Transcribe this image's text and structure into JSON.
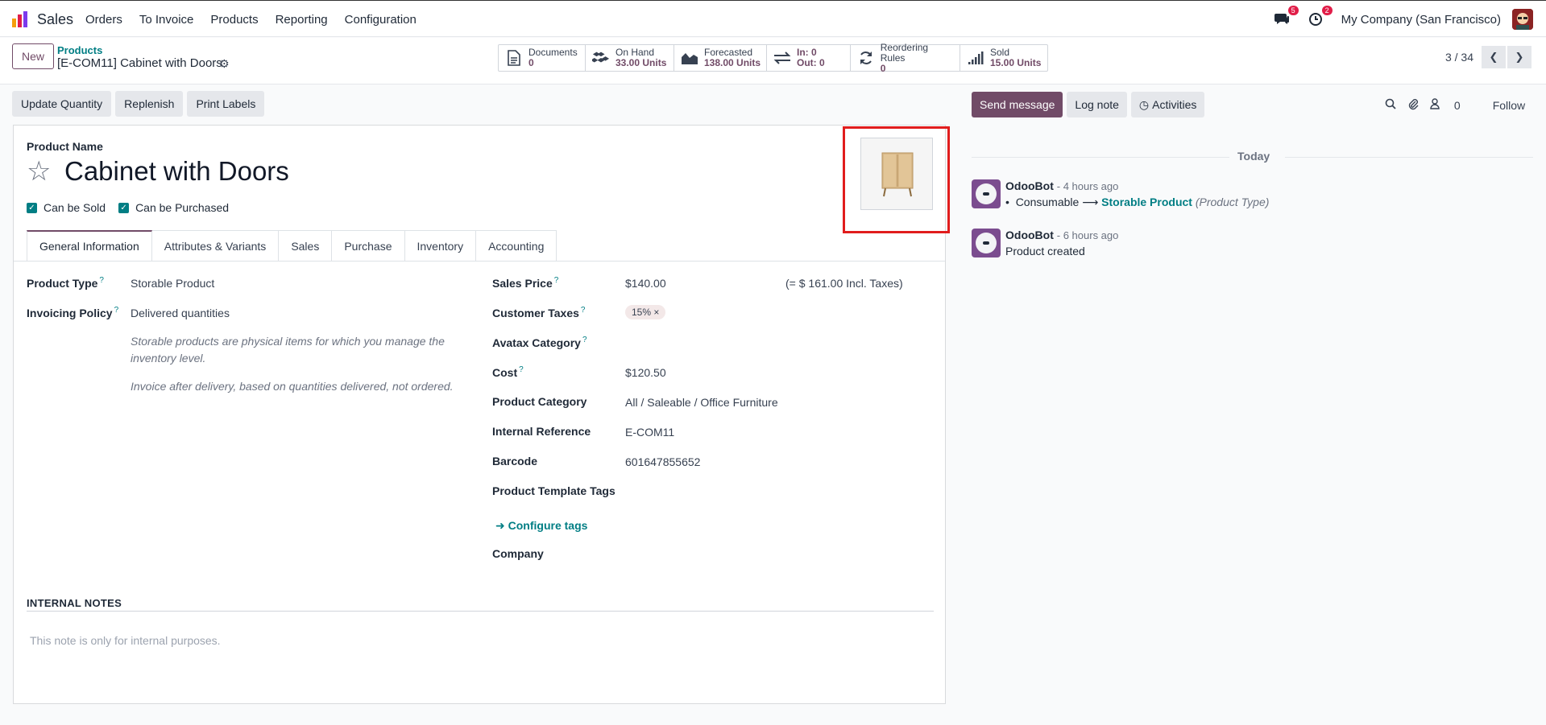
{
  "navbar": {
    "app_name": "Sales",
    "menu": [
      "Orders",
      "To Invoice",
      "Products",
      "Reporting",
      "Configuration"
    ],
    "messages_badge": "5",
    "activities_badge": "2",
    "company": "My Company (San Francisco)"
  },
  "breadcrumb": {
    "new_label": "New",
    "parent": "Products",
    "current": "[E-COM11] Cabinet with Doors"
  },
  "smart_buttons": [
    {
      "icon": "documents-icon",
      "label": "Documents",
      "value": "0"
    },
    {
      "icon": "on-hand-icon",
      "label": "On Hand",
      "value": "33.00 Units"
    },
    {
      "icon": "forecasted-icon",
      "label": "Forecasted",
      "value": "138.00 Units"
    },
    {
      "icon": "in-out-icon",
      "label": "In: 0",
      "value": "Out: 0"
    },
    {
      "icon": "reordering-icon",
      "label": "Reordering Rules",
      "value": "0"
    },
    {
      "icon": "sold-icon",
      "label": "Sold",
      "value": "15.00 Units"
    }
  ],
  "pager": {
    "text": "3 / 34"
  },
  "status_buttons": [
    "Update Quantity",
    "Replenish",
    "Print Labels"
  ],
  "form": {
    "product_name_label": "Product Name",
    "product_name": "Cabinet with Doors",
    "can_be_sold": "Can be Sold",
    "can_be_purchased": "Can be Purchased",
    "tabs": [
      "General Information",
      "Attributes & Variants",
      "Sales",
      "Purchase",
      "Inventory",
      "Accounting"
    ],
    "left": {
      "product_type_label": "Product Type",
      "product_type": "Storable Product",
      "invoicing_policy_label": "Invoicing Policy",
      "invoicing_policy": "Delivered quantities",
      "help1_line1": "Storable products are physical items for which you manage the",
      "help1_line2": "inventory level.",
      "help2": "Invoice after delivery, based on quantities delivered, not ordered."
    },
    "right": {
      "sales_price_label": "Sales Price",
      "sales_price": "$140.00",
      "incl_taxes": "(= $ 161.00 Incl. Taxes)",
      "customer_taxes_label": "Customer Taxes",
      "tax_tag": "15%",
      "avatax_label": "Avatax Category",
      "cost_label": "Cost",
      "cost": "$120.50",
      "category_label": "Product Category",
      "category": "All / Saleable / Office Furniture",
      "internal_ref_label": "Internal Reference",
      "internal_ref": "E-COM11",
      "barcode_label": "Barcode",
      "barcode": "601647855652",
      "tags_label": "Product Template Tags",
      "configure_tags": "Configure tags",
      "company_label": "Company"
    },
    "notes_title": "INTERNAL NOTES",
    "notes_placeholder": "This note is only for internal purposes."
  },
  "chatter": {
    "send_message": "Send message",
    "log_note": "Log note",
    "activities": "Activities",
    "followers_count": "0",
    "follow": "Follow",
    "today": "Today",
    "messages": [
      {
        "author": "OdooBot",
        "time": "- 4 hours ago",
        "old": "Consumable",
        "new": "Storable Product",
        "field": "(Product Type)"
      },
      {
        "author": "OdooBot",
        "time": "- 6 hours ago",
        "body": "Product created"
      }
    ]
  },
  "colors": {
    "brand": "#714b67",
    "link": "#017e84",
    "highlight": "#e11d1d"
  }
}
